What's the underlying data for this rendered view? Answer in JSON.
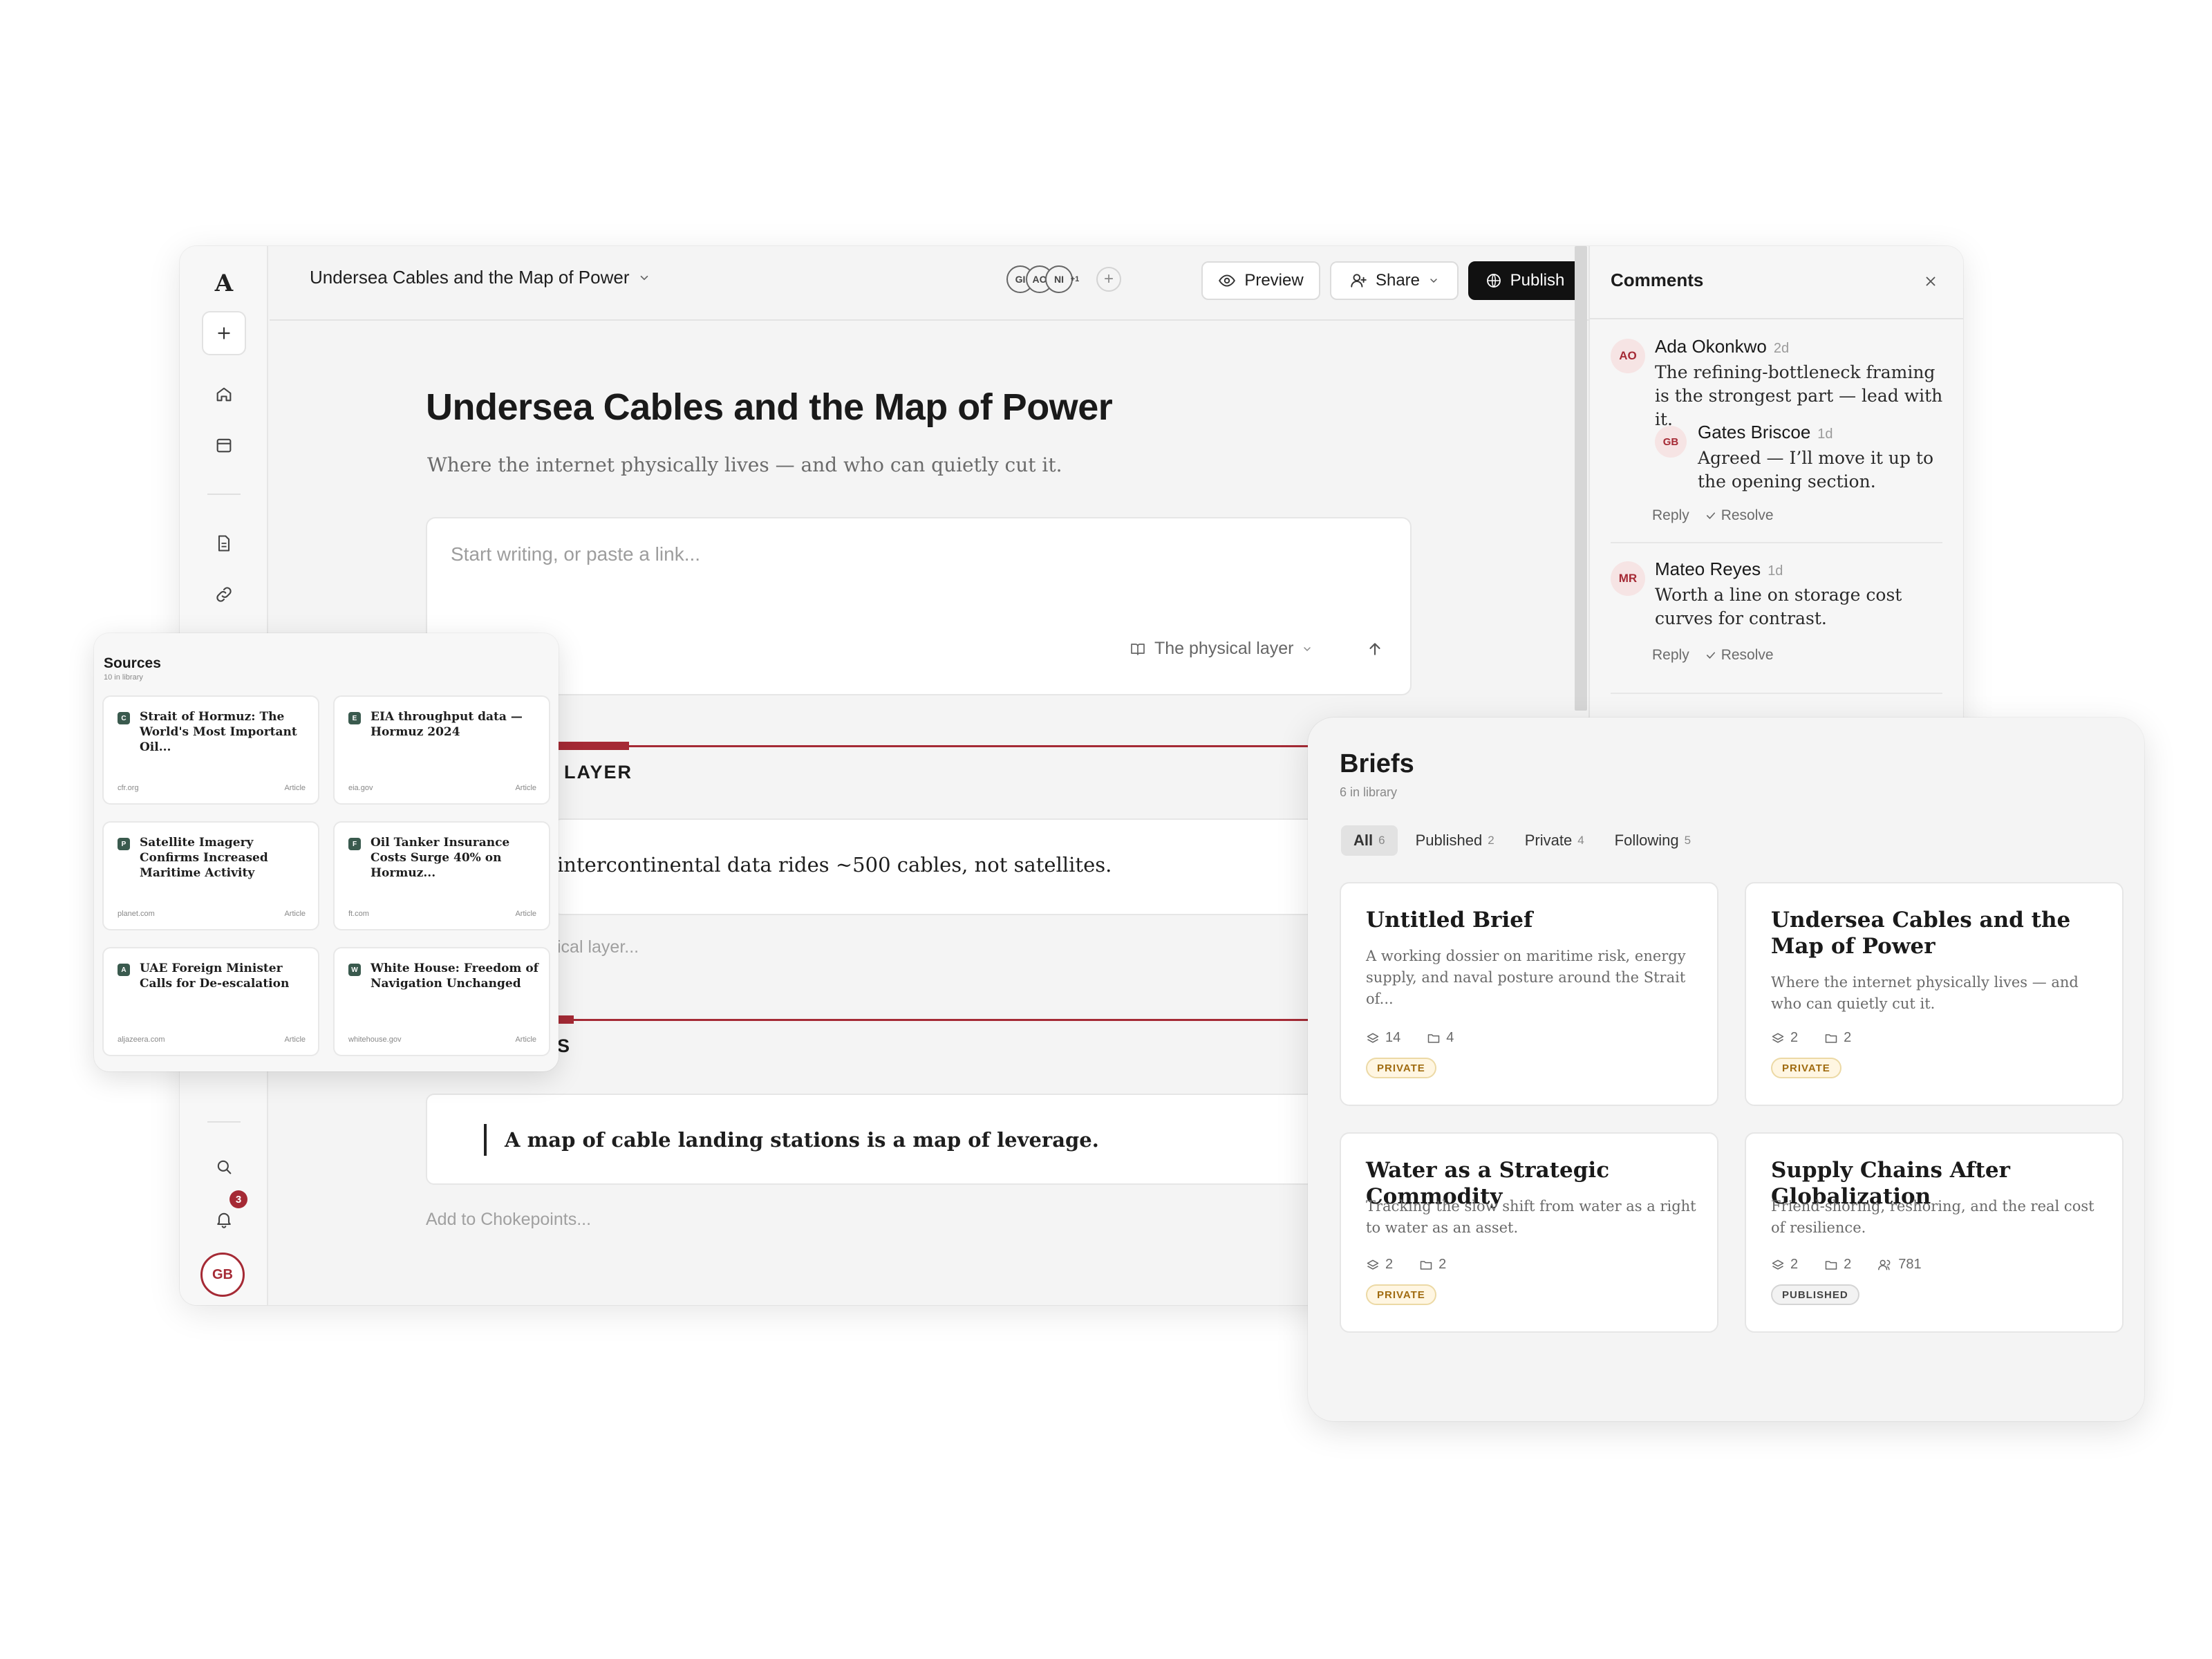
{
  "app": {
    "logo": "A",
    "notifications_count": "3",
    "user_initials": "GB"
  },
  "topbar": {
    "doc_title": "Undersea Cables and the Map of Power",
    "collaborators": [
      "GI",
      "AO",
      "NI"
    ],
    "collaborators_more": "+1",
    "preview_label": "Preview",
    "share_label": "Share",
    "publish_label": "Publish"
  },
  "editor": {
    "title": "Undersea Cables and the Map of Power",
    "subtitle": "Where the internet physically lives — and who can quietly cut it.",
    "composer_placeholder": "Start writing, or paste a link...",
    "composer_section": "The physical layer",
    "section1_title": "LAYER",
    "section1_line": "intercontinental data rides ~500 cables, not satellites.",
    "section1_add": "ical layer...",
    "section2_title": "S",
    "section2_quote": "A map of cable landing stations is a map of leverage.",
    "section2_add": "Add to Chokepoints..."
  },
  "comments": {
    "title": "Comments",
    "reply_label": "Reply",
    "resolve_label": "Resolve",
    "threads": [
      {
        "initials": "AO",
        "name": "Ada Okonkwo",
        "time": "2d",
        "text": "The refining-bottleneck framing is the strongest part — lead with it.",
        "reply": {
          "initials": "GB",
          "name": "Gates Briscoe",
          "time": "1d",
          "text": "Agreed — I’ll move it up to the opening section."
        }
      },
      {
        "initials": "MR",
        "name": "Mateo Reyes",
        "time": "1d",
        "text": "Worth a line on storage cost curves for contrast."
      }
    ]
  },
  "sources": {
    "title": "Sources",
    "subtitle": "10 in library",
    "items": [
      {
        "fav": "C",
        "title": "Strait of Hormuz: The World's Most Important Oil...",
        "domain": "cfr.org",
        "type": "Article"
      },
      {
        "fav": "E",
        "title": "EIA throughput data — Hormuz 2024",
        "domain": "eia.gov",
        "type": "Article"
      },
      {
        "fav": "P",
        "title": "Satellite Imagery Confirms Increased Maritime Activity",
        "domain": "planet.com",
        "type": "Article"
      },
      {
        "fav": "F",
        "title": "Oil Tanker Insurance Costs Surge 40% on Hormuz...",
        "domain": "ft.com",
        "type": "Article"
      },
      {
        "fav": "A",
        "title": "UAE Foreign Minister Calls for De-escalation",
        "domain": "aljazeera.com",
        "type": "Article"
      },
      {
        "fav": "W",
        "title": "White House: Freedom of Navigation Unchanged",
        "domain": "whitehouse.gov",
        "type": "Article"
      }
    ]
  },
  "briefs": {
    "title": "Briefs",
    "subtitle": "6 in library",
    "tabs": [
      {
        "label": "All",
        "count": "6"
      },
      {
        "label": "Published",
        "count": "2"
      },
      {
        "label": "Private",
        "count": "4"
      },
      {
        "label": "Following",
        "count": "5"
      }
    ],
    "items": [
      {
        "title": "Untitled Brief",
        "desc": "A working dossier on maritime risk, energy supply, and naval posture around the Strait of...",
        "layers": "14",
        "folders": "4",
        "badge": "PRIVATE"
      },
      {
        "title": "Undersea Cables and the Map of Power",
        "desc": "Where the internet physically lives — and who can quietly cut it.",
        "layers": "2",
        "folders": "2",
        "badge": "PRIVATE"
      },
      {
        "title": "Water as a Strategic Commodity",
        "desc": "Tracking the slow shift from water as a right to water as an asset.",
        "layers": "2",
        "folders": "2",
        "badge": "PRIVATE"
      },
      {
        "title": "Supply Chains After Globalization",
        "desc": "Friend-shoring, reshoring, and the real cost of resilience.",
        "layers": "2",
        "folders": "2",
        "followers": "781",
        "badge": "PUBLISHED"
      }
    ]
  },
  "colors": {
    "accent": "#a52a35",
    "publish_bg": "#111111",
    "private_badge": "#a06b10",
    "favicon": "#3a5a4e"
  },
  "icons": [
    "plus-icon",
    "home-icon",
    "calendar-icon",
    "document-icon",
    "link-icon",
    "search-icon",
    "bell-icon",
    "chevron-down-icon",
    "eye-icon",
    "user-plus-icon",
    "globe-icon",
    "comment-icon",
    "more-icon",
    "close-icon",
    "check-icon",
    "book-icon",
    "arrow-up-icon",
    "layers-icon",
    "folder-icon",
    "users-icon"
  ]
}
